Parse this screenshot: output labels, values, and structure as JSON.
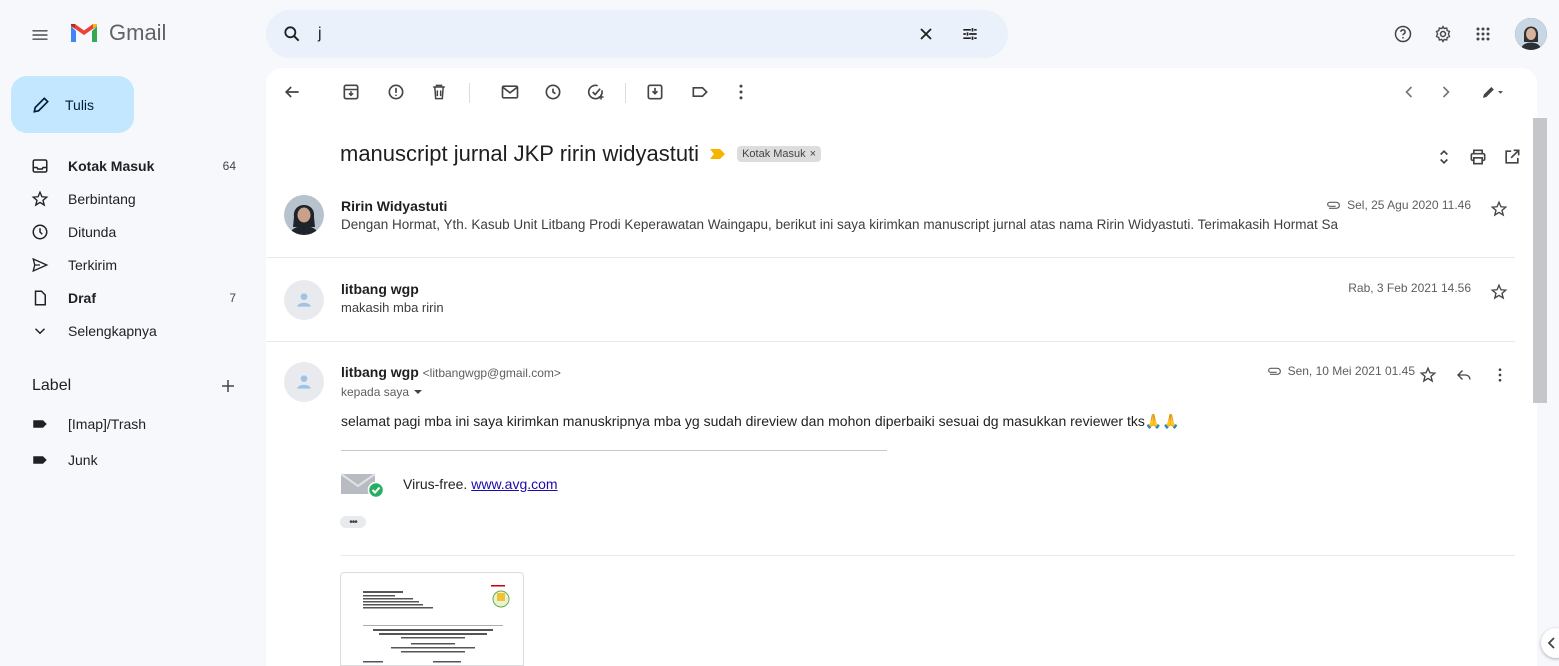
{
  "app": {
    "name": "Gmail"
  },
  "search": {
    "query": "j"
  },
  "compose": {
    "label": "Tulis"
  },
  "sidebar": {
    "items": [
      {
        "label": "Kotak Masuk",
        "count": "64",
        "bold": true,
        "icon": "inbox-icon"
      },
      {
        "label": "Berbintang",
        "count": "",
        "bold": false,
        "icon": "star-icon"
      },
      {
        "label": "Ditunda",
        "count": "",
        "bold": false,
        "icon": "clock-icon"
      },
      {
        "label": "Terkirim",
        "count": "",
        "bold": false,
        "icon": "send-icon"
      },
      {
        "label": "Draf",
        "count": "7",
        "bold": true,
        "icon": "draft-icon"
      },
      {
        "label": "Selengkapnya",
        "count": "",
        "bold": false,
        "icon": "chevron-down-icon"
      }
    ],
    "labels_heading": "Label",
    "labels": [
      {
        "label": "[Imap]/Trash",
        "icon": "label-icon"
      },
      {
        "label": "Junk",
        "icon": "label-icon"
      }
    ]
  },
  "thread": {
    "subject": "manuscript jurnal JKP ririn widyastuti",
    "chip": "Kotak Masuk",
    "messages": [
      {
        "from": "Ririn Widyastuti",
        "snippet": "Dengan Hormat, Yth. Kasub Unit Litbang Prodi Keperawatan Waingapu, berikut ini saya kirimkan manuscript jurnal atas nama Ririn Widyastuti. Terimakasih Hormat Sa",
        "date": "Sel, 25 Agu 2020 11.46"
      },
      {
        "from": "litbang wgp",
        "snippet": "makasih mba ririn",
        "date": "Rab, 3 Feb 2021 14.56"
      },
      {
        "from": "litbang wgp",
        "email": "<litbangwgp@gmail.com>",
        "to": "kepada saya",
        "date": "Sen, 10 Mei 2021 01.45",
        "body": "selamat pagi mba ini saya kirimkan manuskripnya mba yg sudah direview dan mohon diperbaiki sesuai dg masukkan reviewer tks🙏🙏",
        "signature_text": "Virus-free.",
        "signature_link": "www.avg.com",
        "ellipsis": "•••"
      }
    ]
  },
  "colors": {
    "background": "#f6f8fc",
    "compose": "#c2e7ff",
    "search": "#eaf1fb",
    "link": "#1a0dab",
    "importance": "#f4b400"
  }
}
